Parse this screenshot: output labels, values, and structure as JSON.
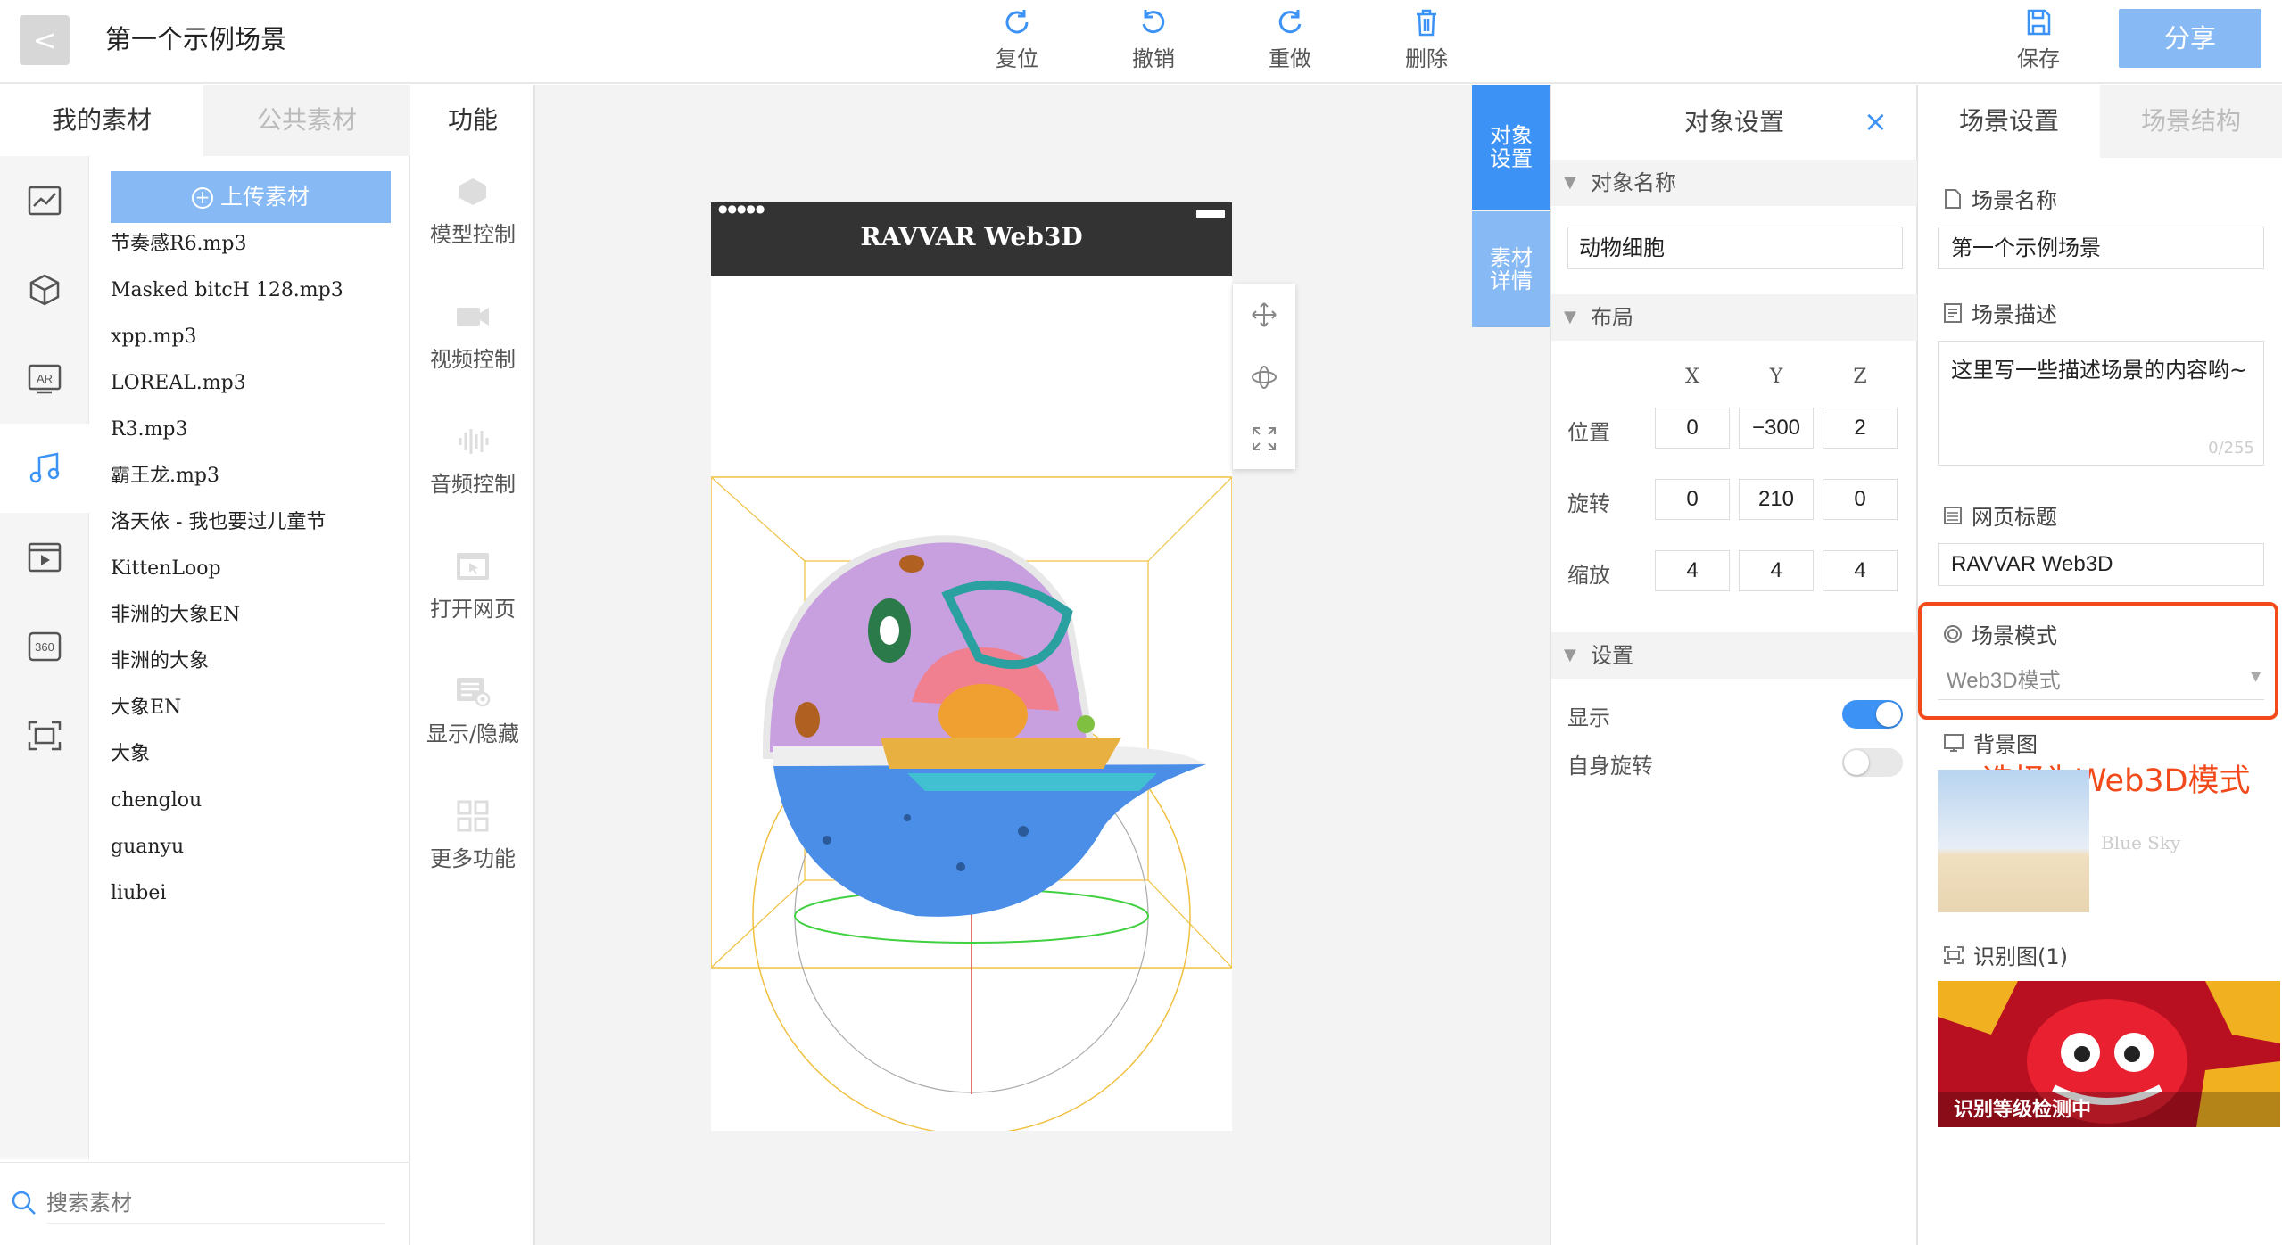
{
  "topbar": {
    "back_label": "<",
    "title": "第一个示例场景",
    "reset": "复位",
    "undo": "撤销",
    "redo": "重做",
    "delete": "删除",
    "save": "保存",
    "share": "分享"
  },
  "left": {
    "tab_my": "我的素材",
    "tab_public": "公共素材",
    "tab_func": "功能",
    "upload": "上传素材",
    "files": [
      "节奏感R6.mp3",
      "Masked bitcH 128.mp3",
      "xpp.mp3",
      "LOREAL.mp3",
      "R3.mp3",
      "霸王龙.mp3",
      "洛天依 - 我也要过儿童节",
      "KittenLoop",
      "非洲的大象EN",
      "非洲的大象",
      "大象EN",
      "大象",
      "chenglou",
      "guanyu",
      "liubei"
    ],
    "search_placeholder": "搜索素材",
    "sidebar_icons": [
      "chart-icon",
      "cube-icon",
      "ar-icon",
      "music-icon",
      "video-icon",
      "360-icon",
      "scan-icon"
    ]
  },
  "functions": [
    "模型控制",
    "视频控制",
    "音频控制",
    "打开网页",
    "显示/隐藏",
    "更多功能"
  ],
  "phone": {
    "header_title": "RAVVAR Web3D",
    "signal": "●●●●●"
  },
  "object_tabs": {
    "settings": "对象\n设置",
    "details": "素材\n详情"
  },
  "object_settings": {
    "title": "对象设置",
    "name_section": "对象名称",
    "name_value": "动物细胞",
    "layout_section": "布局",
    "axis": [
      "X",
      "Y",
      "Z"
    ],
    "position_label": "位置",
    "position": [
      "0",
      "−300",
      "2"
    ],
    "rotation_label": "旋转",
    "rotation": [
      "0",
      "210",
      "0"
    ],
    "scale_label": "缩放",
    "scale": [
      "4",
      "4",
      "4"
    ],
    "settings_section": "设置",
    "show_label": "显示",
    "show_on": true,
    "spin_label": "自身旋转",
    "spin_on": false
  },
  "scene_settings": {
    "tab_settings": "场景设置",
    "tab_structure": "场景结构",
    "name_label": "场景名称",
    "name_value": "第一个示例场景",
    "desc_label": "场景描述",
    "desc_value": "这里写一些描述场景的内容哟~",
    "desc_count": "0/255",
    "page_title_label": "网页标题",
    "page_title_value": "RAVVAR Web3D",
    "mode_label": "场景模式",
    "mode_value": "Web3D模式",
    "annotation": "选择为Web3D模式",
    "bg_label": "背景图",
    "bg_caption": "Blue Sky",
    "recog_label": "识别图(1)",
    "recog_caption": "识别等级检测中"
  },
  "colors": {
    "accent": "#3d93f5",
    "accent_light": "#87baf4",
    "annotation_red": "#f24a1a"
  }
}
